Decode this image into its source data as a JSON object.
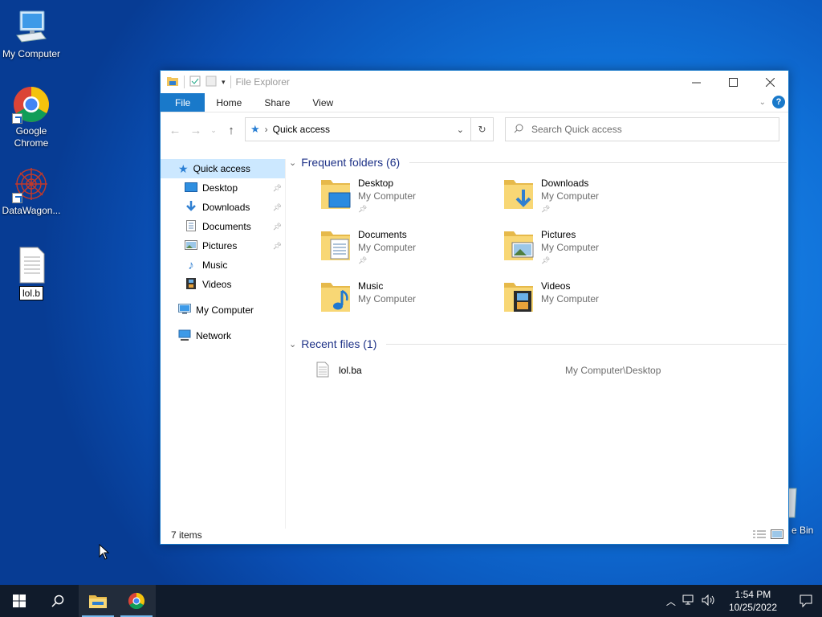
{
  "desktop": {
    "icons": [
      {
        "label": "My Computer"
      },
      {
        "label": "Google Chrome"
      },
      {
        "label": "DataWagon..."
      },
      {
        "label": "lol.b"
      }
    ],
    "recycle_label": "e Bin"
  },
  "window": {
    "title": "File Explorer",
    "tabs": {
      "file": "File",
      "home": "Home",
      "share": "Share",
      "view": "View"
    },
    "address": "Quick access",
    "search_placeholder": "Search Quick access",
    "nav": {
      "quick_access": "Quick access",
      "items": [
        {
          "label": "Desktop",
          "pinned": true
        },
        {
          "label": "Downloads",
          "pinned": true
        },
        {
          "label": "Documents",
          "pinned": true
        },
        {
          "label": "Pictures",
          "pinned": true
        },
        {
          "label": "Music",
          "pinned": false
        },
        {
          "label": "Videos",
          "pinned": false
        }
      ],
      "my_computer": "My Computer",
      "network": "Network"
    },
    "frequent": {
      "heading": "Frequent folders (6)",
      "folders": [
        {
          "name": "Desktop",
          "location": "My Computer"
        },
        {
          "name": "Downloads",
          "location": "My Computer"
        },
        {
          "name": "Documents",
          "location": "My Computer"
        },
        {
          "name": "Pictures",
          "location": "My Computer"
        },
        {
          "name": "Music",
          "location": "My Computer"
        },
        {
          "name": "Videos",
          "location": "My Computer"
        }
      ]
    },
    "recent": {
      "heading": "Recent files (1)",
      "files": [
        {
          "name": "lol.ba",
          "path": "My Computer\\Desktop"
        }
      ]
    },
    "status": "7 items"
  },
  "taskbar": {
    "time": "1:54 PM",
    "date": "10/25/2022"
  },
  "colors": {
    "accent": "#1979ca",
    "selection": "#cce8ff",
    "group_heading": "#1e3287",
    "taskbar": "#101b2b"
  }
}
